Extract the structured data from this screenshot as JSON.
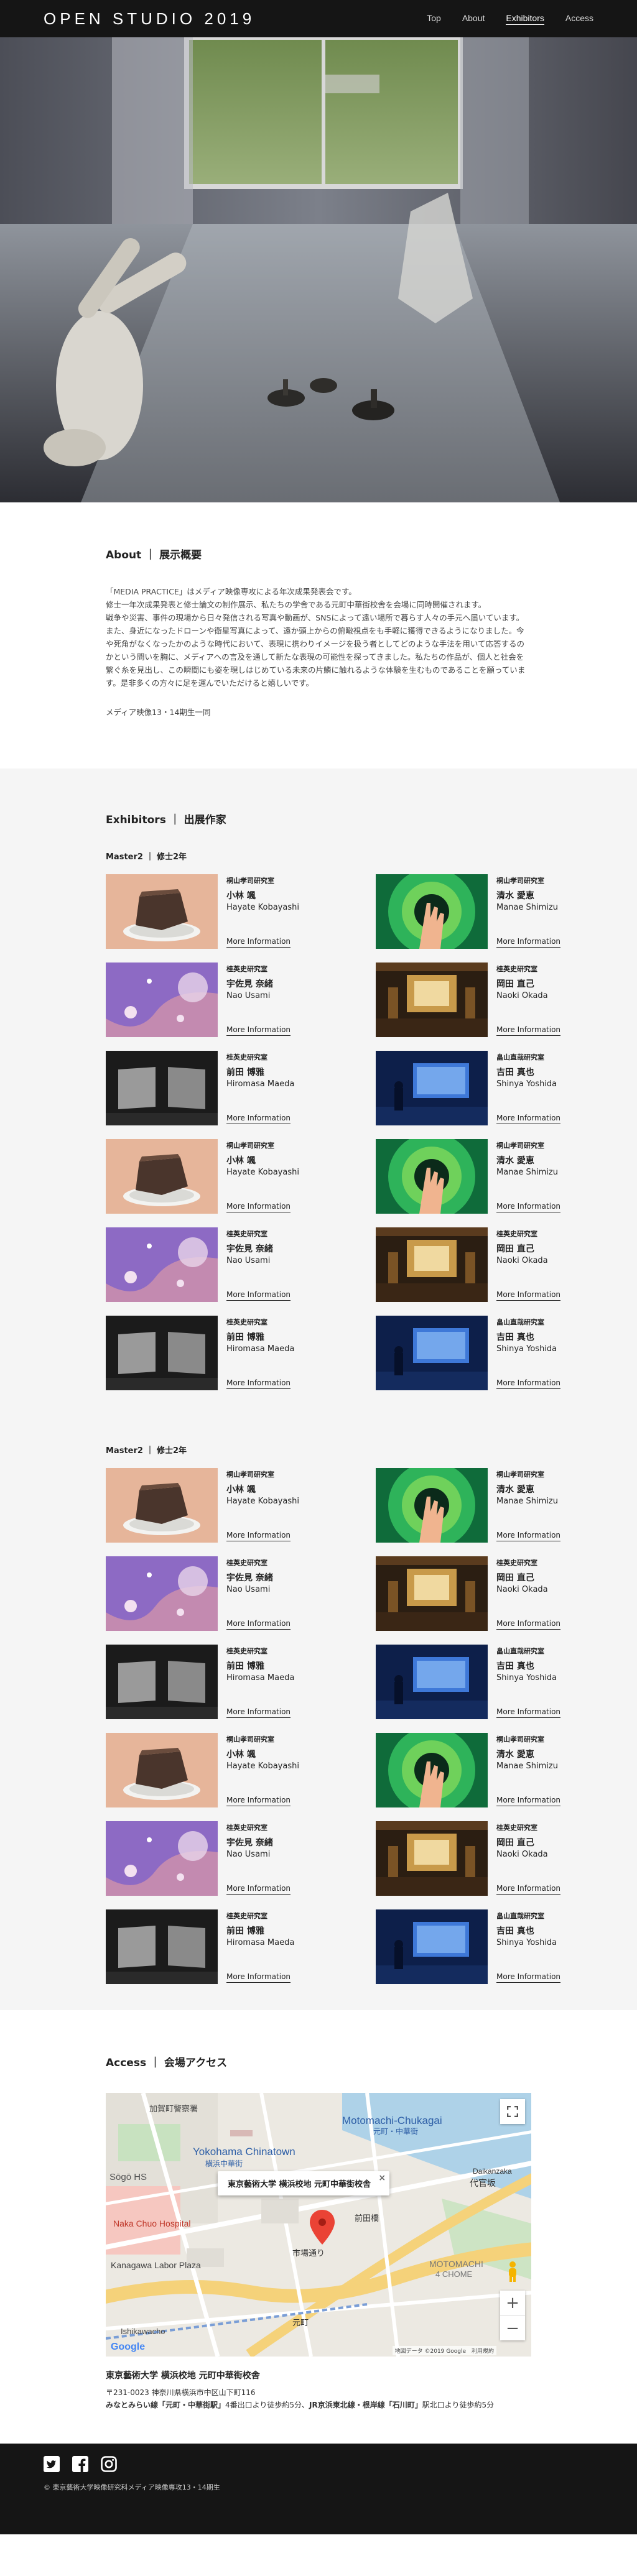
{
  "header": {
    "logo": "OPEN STUDIO 2019",
    "nav": [
      {
        "label": "Top"
      },
      {
        "label": "About"
      },
      {
        "label": "Exhibitors"
      },
      {
        "label": "Access"
      }
    ]
  },
  "about": {
    "title": "About ｜ 展示概要",
    "p1": "「MEDIA PRACTICE」はメディア映像専攻による年次成果発表会です。",
    "p2": "修士一年次成果発表と修士論文の制作展示、私たちの学舎である元町中華街校舎を会場に同時開催されます。",
    "p3": "戦争や災害、事件の現場から日々発信される写真や動画が、SNSによって遠い場所で暮らす人々の手元へ届いています。また、身近になったドローンや衛星写真によって、遠か頭上からの俯瞰視点をも手軽に獲得できるようになりました。今や死角がなくなったかのような時代において、表現に携わりイメージを扱う者としてどのような手法を用いて応答するのかという問いを胸に、メディアへの言及を通して新たな表現の可能性を探ってきました。私たちの作品が、個人と社会を繋ぐ糸を見出し、この瞬間にも姿を現しはじめている未来の片鱗に触れるような体験を生むものであることを願っています。是非多くの方々に足を運んでいただけると嬉しいです。",
    "signature": "メディア映像13・14期生一同"
  },
  "exhibitors": {
    "title": "Exhibitors ｜ 出展作家",
    "more_label": "More Information",
    "groups": [
      {
        "title": "Master2 ｜ 修士2年"
      },
      {
        "title": "Master2 ｜ 修士2年"
      }
    ],
    "people": [
      {
        "lab": "桐山孝司研究室",
        "jp": "小林 颯",
        "en": "Hayate Kobayashi",
        "thumb": "cake"
      },
      {
        "lab": "桐山孝司研究室",
        "jp": "清水 愛恵",
        "en": "Manae Shimizu",
        "thumb": "hand"
      },
      {
        "lab": "桂英史研究室",
        "jp": "宇佐見 奈緒",
        "en": "Nao Usami",
        "thumb": "pink"
      },
      {
        "lab": "桂英史研究室",
        "jp": "岡田 直己",
        "en": "Naoki Okada",
        "thumb": "theater"
      },
      {
        "lab": "桂英史研究室",
        "jp": "前田 博雅",
        "en": "Hiromasa Maeda",
        "thumb": "screens"
      },
      {
        "lab": "畠山直哉研究室",
        "jp": "吉田 真也",
        "en": "Shinya Yoshida",
        "thumb": "blue"
      }
    ]
  },
  "access": {
    "title": "Access ｜ 会場アクセス",
    "map": {
      "popup": "東京藝術大学 横浜校地 元町中華街校舎",
      "close": "×",
      "zoom_in": "+",
      "zoom_out": "−",
      "google": "Google",
      "footer": "地図データ ©2019 Google　利用規約",
      "labels": [
        {
          "text": "Yokohama Chinatown"
        },
        {
          "text": "横浜中華街"
        },
        {
          "text": "Motomachi-Chukagai"
        },
        {
          "text": "元町・中華街"
        },
        {
          "text": "Kanagawa Labor Plaza"
        },
        {
          "text": "Naka Chuo Hospital"
        },
        {
          "text": "Ishikawacho"
        },
        {
          "text": "前田橋"
        },
        {
          "text": "市場通り"
        },
        {
          "text": "代官坂"
        },
        {
          "text": "Sōgō HS"
        },
        {
          "text": "MOTOMACHI"
        },
        {
          "text": "4 CHOME"
        },
        {
          "text": "加賀町警察署"
        },
        {
          "text": "元町"
        },
        {
          "text": "Daikanzaka"
        }
      ]
    },
    "name": "東京藝術大学 横浜校地 元町中華街校舎",
    "postal": "〒231-0023 神奈川県横浜市中区山下町116",
    "line_a": "みなとみらい線「元町・中華街駅」",
    "line_b": "4番出口より徒歩約5分、",
    "line_c": "JR京浜東北線・根岸線「石川町」",
    "line_d": "駅北口より徒歩約5分"
  },
  "footer": {
    "copyright": "© 東京藝術大学映像研究科メディア映像専攻13・14期生"
  }
}
